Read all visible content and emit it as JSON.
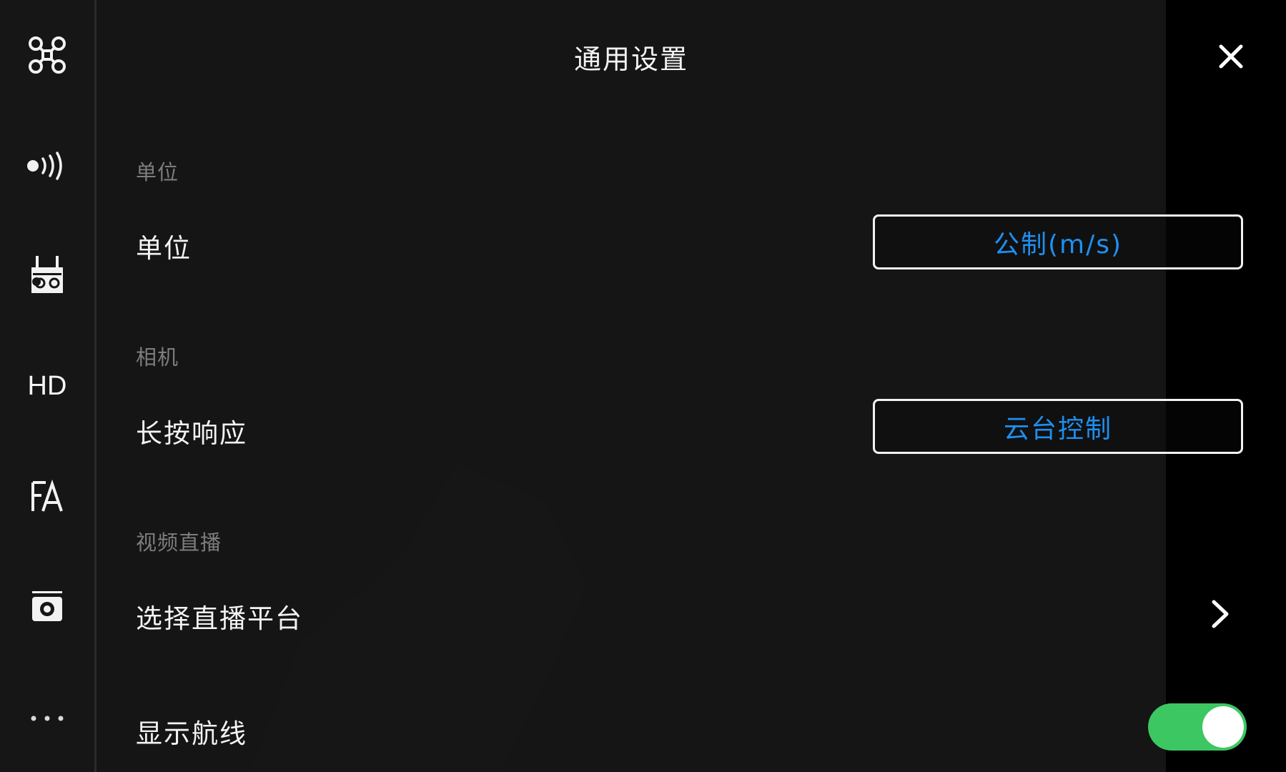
{
  "sidebar": {
    "items": [
      {
        "icon": "drone-icon"
      },
      {
        "icon": "signal-icon"
      },
      {
        "icon": "remote-controller-icon"
      },
      {
        "icon": "hd-icon",
        "label": "HD"
      },
      {
        "icon": "language-icon"
      },
      {
        "icon": "camera-icon"
      },
      {
        "icon": "more-icon",
        "label": "···"
      }
    ]
  },
  "header": {
    "title": "通用设置",
    "close_icon": "close-icon"
  },
  "settings": {
    "units_section": "单位",
    "units_label": "单位",
    "units_value": "公制(m/s)",
    "camera_section": "相机",
    "long_press_label": "长按响应",
    "long_press_value": "云台控制",
    "live_section": "视频直播",
    "live_platform_label": "选择直播平台",
    "show_route_label": "显示航线",
    "show_route_enabled": true
  },
  "colors": {
    "accent_blue": "#1f8ff0",
    "toggle_green": "#3cc763",
    "panel_bg": "#161616"
  }
}
